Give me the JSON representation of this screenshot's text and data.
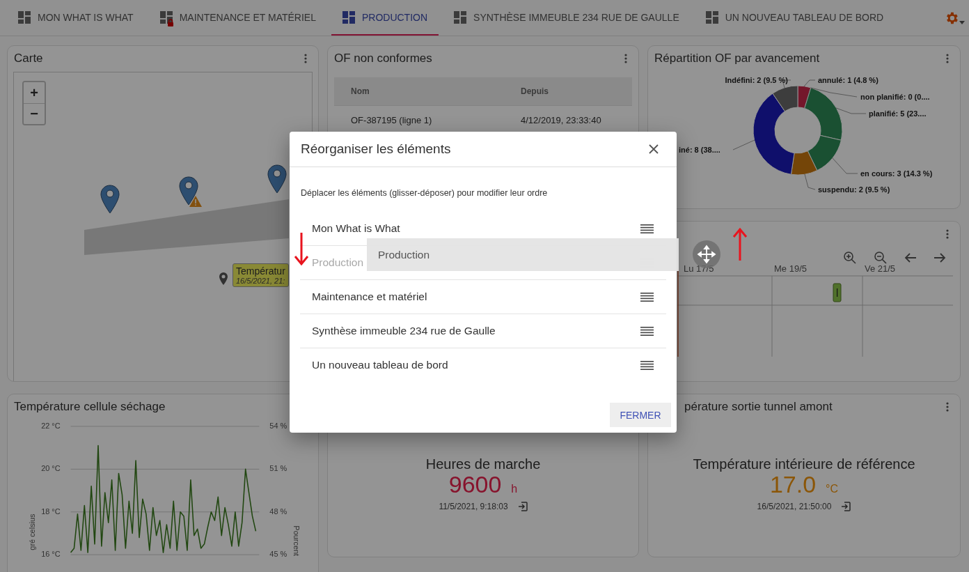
{
  "tabs": [
    {
      "label": "MON WHAT IS WHAT",
      "selected": false,
      "locked": false
    },
    {
      "label": "MAINTENANCE ET MATÉRIEL",
      "selected": false,
      "locked": true
    },
    {
      "label": "PRODUCTION",
      "selected": true,
      "locked": false
    },
    {
      "label": "SYNTHÈSE IMMEUBLE 234 RUE DE GAULLE",
      "selected": false,
      "locked": false
    },
    {
      "label": "UN NOUVEAU TABLEAU DE BORD",
      "selected": false,
      "locked": false
    }
  ],
  "map_card": {
    "title": "Carte",
    "zoom_in": "+",
    "zoom_out": "−",
    "pins": [
      {
        "warning": false
      },
      {
        "warning": true
      },
      {
        "warning": false
      }
    ],
    "tooltip": {
      "title": "Températur",
      "time": "16/5/2021, 21:"
    }
  },
  "of_card": {
    "title": "OF non conformes",
    "columns": [
      "Nom",
      "Depuis"
    ],
    "rows": [
      [
        "OF-387195 (ligne 1)",
        "4/12/2019, 23:33:40"
      ]
    ]
  },
  "donut_card": {
    "title": "Répartition OF par avancement",
    "chart_data": {
      "type": "donut",
      "categories": [
        "annulé: 1 (4.8 %)",
        "non planifié: 0 (0....",
        "planifié: 5 (23....",
        "en cours: 3 (14.3 %)",
        "suspendu: 2 (9.5 %)",
        "iné: 8 (38....",
        "Indéfini: 2 (9.5 %)"
      ],
      "values": [
        1,
        0,
        5,
        3,
        2,
        8,
        2
      ],
      "colors": [
        "#c8284a",
        "#888888",
        "#2e8b57",
        "#2e8b57",
        "#c8780f",
        "#1a1ab8",
        "#6a6a6a"
      ]
    }
  },
  "timeline_card": {
    "days": [
      "Lu 17/5",
      "Me 19/5",
      "Ve 21/5"
    ]
  },
  "temp_chart_card": {
    "title": "Température cellule séchage",
    "chart_data": {
      "type": "line",
      "ylabel": "gré celsius",
      "grid": true,
      "ylim": [
        16,
        22
      ],
      "yticks": [
        {
          "value": 22,
          "label": "22 °C"
        },
        {
          "value": 20,
          "label": "20 °C"
        },
        {
          "value": 18,
          "label": "18 °C"
        },
        {
          "value": 16,
          "label": "16 °C"
        }
      ],
      "series": [
        {
          "color": "#3a7a1e",
          "values": [
            16.1,
            16.3,
            17.9,
            16.2,
            18.3,
            16.1,
            19.2,
            16.5,
            21.1,
            16.4,
            18.9,
            17.5,
            19.5,
            16.2,
            19.8,
            18.8,
            16.3,
            18.5,
            17.0,
            20.4,
            16.8,
            18.6,
            17.9,
            16.2,
            18.2,
            16.9,
            17.6,
            16.1,
            17.4,
            16.3,
            18.5,
            16.2,
            18.0,
            17.8,
            16.2,
            19.5,
            16.9,
            17.2,
            16.3,
            16.5,
            17.3,
            18.0,
            17.6,
            18.7,
            16.9,
            18.2,
            17.4,
            16.4,
            18.0,
            16.4,
            17.5,
            20.0,
            18.9,
            17.8,
            17.1
          ]
        }
      ]
    },
    "right_axis": {
      "label": "Pourcent",
      "ticks": [
        "54 %",
        "51 %",
        "48 %",
        "45 %"
      ]
    }
  },
  "kpi_cards": [
    {
      "heading": "Heures de marche",
      "value": "9600",
      "unit": "h",
      "kind": "hours",
      "time": "11/5/2021, 9:18:03"
    },
    {
      "title": "pérature sortie tunnel amont",
      "heading": "Température intérieure de référence",
      "value": "17.0",
      "unit": "°C",
      "kind": "temperature",
      "time": "16/5/2021, 21:50:00"
    }
  ],
  "dialog": {
    "title": "Réorganiser les éléments",
    "description": "Déplacer les éléments (glisser-déposer) pour modifier leur ordre",
    "items": [
      {
        "label": "Mon What is What",
        "dragging": false
      },
      {
        "label": "Production",
        "dragging": true
      },
      {
        "label": "Maintenance et matériel",
        "dragging": false
      },
      {
        "label": "Synthèse immeuble 234 rue de Gaulle",
        "dragging": false
      },
      {
        "label": "Un nouveau tableau de bord",
        "dragging": false
      }
    ],
    "drag_ghost": "Production",
    "button": "FERMER"
  },
  "annotation_arrows": [
    {
      "kind": "down"
    },
    {
      "kind": "up"
    }
  ]
}
